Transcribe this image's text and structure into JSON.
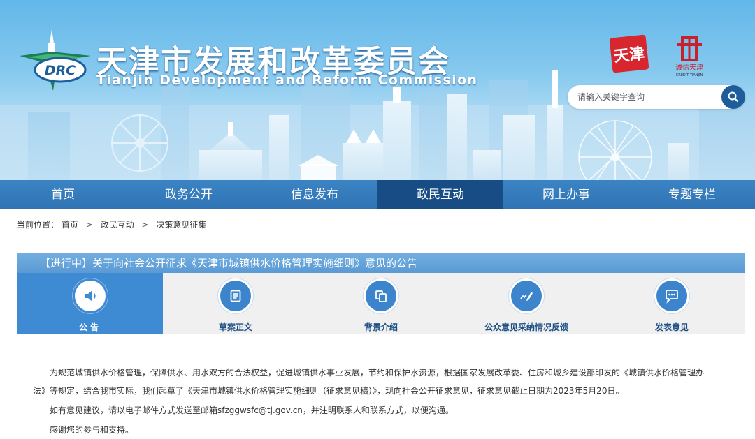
{
  "header": {
    "title": "天津市发展和改革委员会",
    "subtitle": "Tianjin Development and Reform Commission",
    "logo_text": "DRC",
    "seal_text": "天津",
    "credit_text": "诚信天津",
    "credit_sub": "CREDIT TIANJIN",
    "search_placeholder": "请输入关键字查询"
  },
  "nav": {
    "items": [
      {
        "label": "首页"
      },
      {
        "label": "政务公开"
      },
      {
        "label": "信息发布"
      },
      {
        "label": "政民互动"
      },
      {
        "label": "网上办事"
      },
      {
        "label": "专题专栏"
      }
    ],
    "active_index": 3
  },
  "breadcrumb": {
    "prefix": "当前位置：",
    "items": [
      "首页",
      "政民互动",
      "决策意见征集"
    ],
    "separator": ">"
  },
  "notice": {
    "title": "【进行中】关于向社会公开征求《天津市城镇供水价格管理实施细则》意见的公告",
    "tabs": [
      {
        "label": "公告",
        "icon": "speaker-icon"
      },
      {
        "label": "草案正文",
        "icon": "document-icon"
      },
      {
        "label": "背景介绍",
        "icon": "copy-icon"
      },
      {
        "label": "公众意见采纳情况反馈",
        "icon": "hand-write-icon"
      },
      {
        "label": "发表意见",
        "icon": "chat-icon"
      }
    ],
    "active_tab": 0,
    "paragraphs": [
      "为规范城镇供水价格管理，保障供水、用水双方的合法权益，促进城镇供水事业发展，节约和保护水资源，根据国家发展改革委、住房和城乡建设部印发的《城镇供水价格管理办",
      "法》等规定，结合我市实际，我们起草了《天津市城镇供水价格管理实施细则（征求意见稿）》，现向社会公开征求意见，征求意见截止日期为2023年5月20日。",
      "如有意见建议，请以电子邮件方式发送至邮箱sfzggwsfc@tj.gov.cn，并注明联系人和联系方式，以便沟通。",
      "感谢您的参与和支持。"
    ]
  },
  "colors": {
    "nav_bg": "#2f73b4",
    "nav_active": "#174c85",
    "panel_title": "#5a9ad5",
    "tab_active": "#3e8bd3",
    "tab_label": "#1d4f86",
    "seal": "#d8262f"
  }
}
